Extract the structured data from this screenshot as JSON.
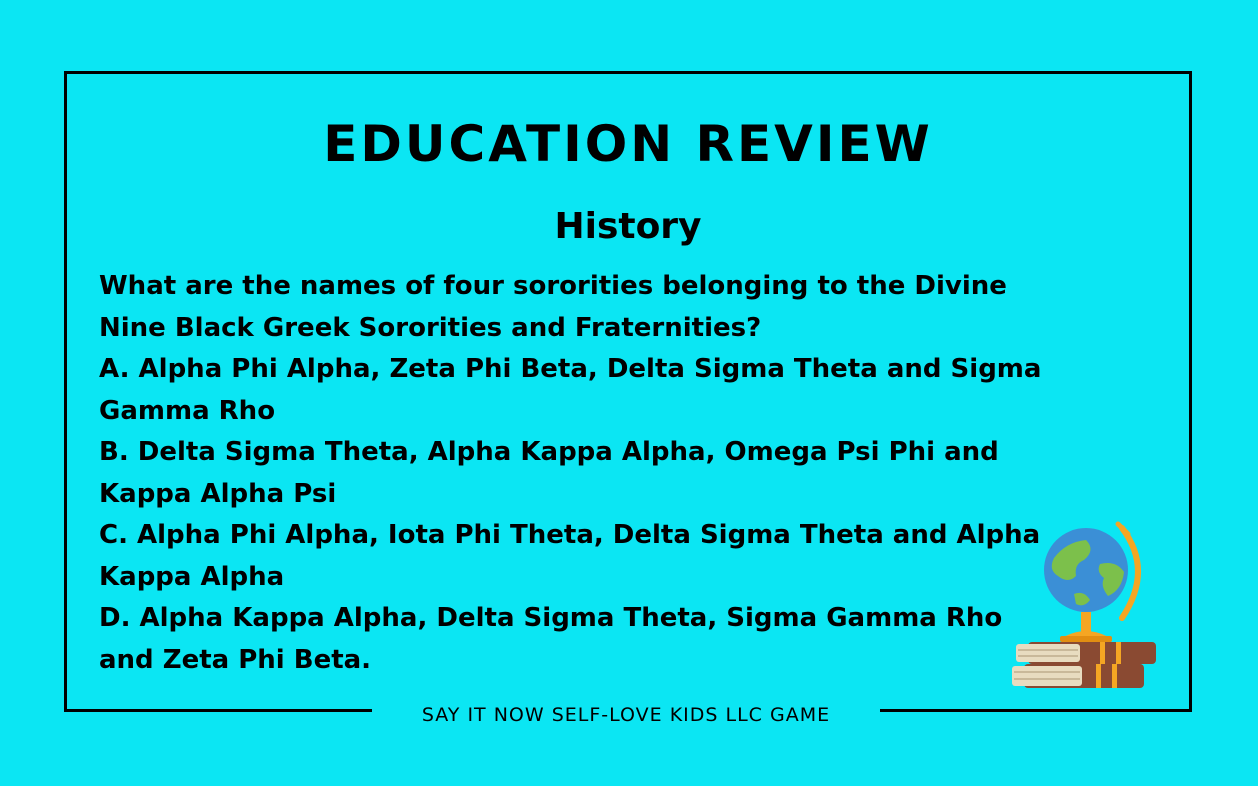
{
  "card": {
    "title": "EDUCATION REVIEW",
    "subtitle": "History",
    "question": "What are the names of four sororities belonging to the Divine Nine Black Greek Sororities and Fraternities?",
    "options": [
      "A. Alpha Phi Alpha, Zeta Phi Beta, Delta Sigma Theta and Sigma Gamma Rho",
      "B. Delta Sigma Theta, Alpha Kappa Alpha, Omega Psi Phi and Kappa Alpha Psi",
      "C. Alpha Phi Alpha, Iota Phi Theta, Delta Sigma Theta and Alpha Kappa Alpha",
      "D. Alpha Kappa Alpha, Delta Sigma Theta, Sigma Gamma Rho and Zeta Phi Beta."
    ],
    "footer": "SAY IT NOW SELF-LOVE KIDS LLC GAME"
  },
  "illustration": {
    "icon": "globe-on-books-icon"
  },
  "colors": {
    "background": "#0be6f3",
    "text": "#000000",
    "globe_ocean": "#3b8fd6",
    "globe_land": "#7cc04b",
    "stand": "#f5a623",
    "book_brown": "#8a4a32",
    "book_cream": "#e8dcc0"
  }
}
